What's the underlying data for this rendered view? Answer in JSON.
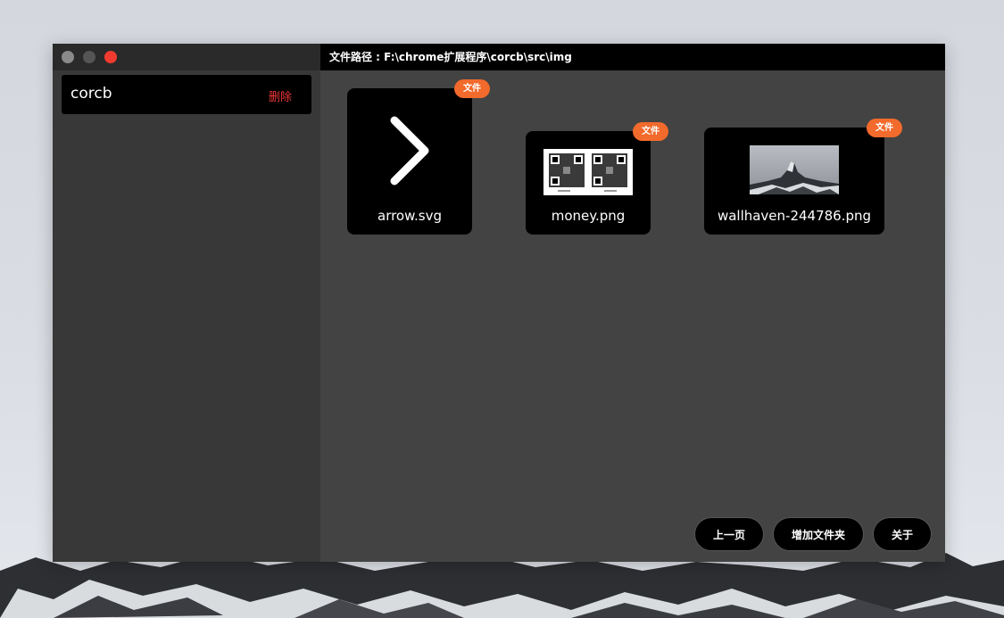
{
  "sidebar": {
    "folders": [
      {
        "name": "corcb",
        "delete_label": "删除"
      }
    ]
  },
  "header": {
    "path_label": "文件路径 : ",
    "path_value": "F:\\chrome扩展程序\\corcb\\src\\img"
  },
  "files": [
    {
      "name": "arrow.svg",
      "badge": "文件",
      "icon": "chevron-right-icon"
    },
    {
      "name": "money.png",
      "badge": "文件",
      "icon": "qr-code-image"
    },
    {
      "name": "wallhaven-244786.png",
      "badge": "文件",
      "icon": "mountain-image"
    }
  ],
  "footer": {
    "prev_label": "上一页",
    "add_folder_label": "增加文件夹",
    "about_label": "关于"
  },
  "colors": {
    "badge": "#f26a2c",
    "delete": "#ee3535",
    "close_light": "#f23b30"
  }
}
